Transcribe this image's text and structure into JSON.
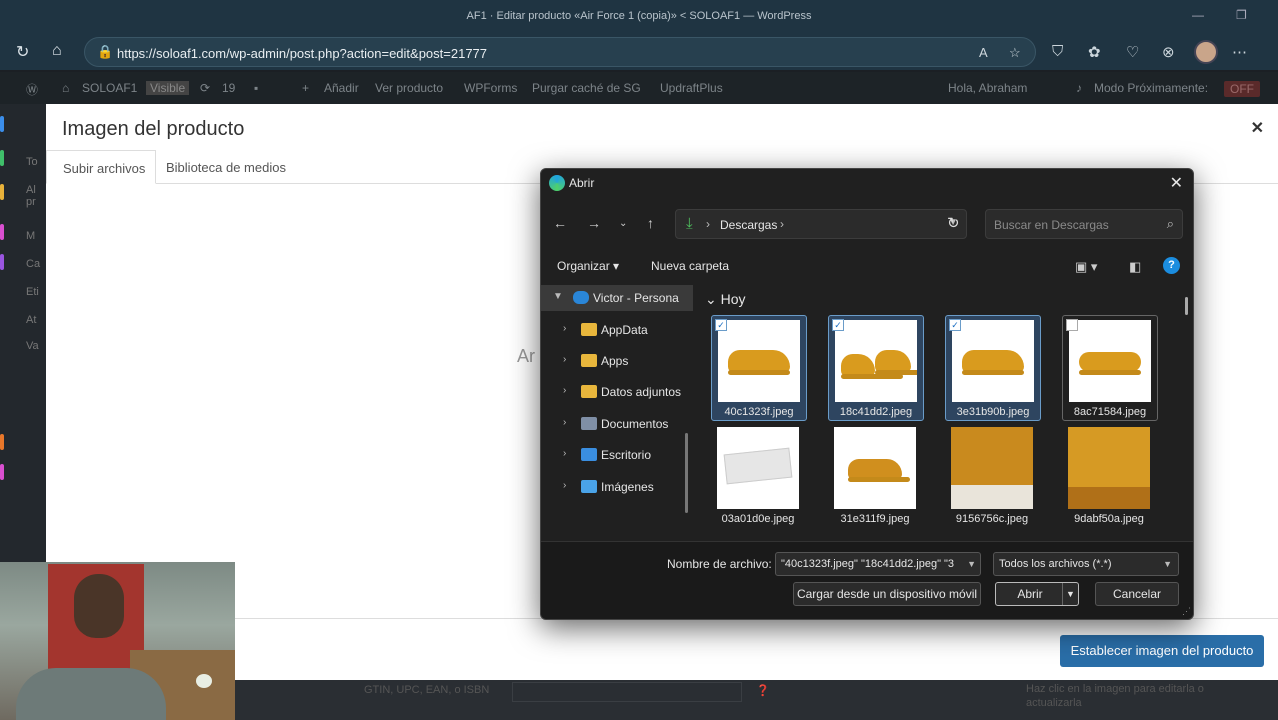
{
  "browser": {
    "window_title": "AF1 · Editar producto «Air Force 1 (copia)» < SOLOAF1 — WordPress",
    "url": "https://soloaf1.com/wp-admin/post.php?action=edit&post=21777"
  },
  "wp_admin_bar": {
    "site": "SOLOAF1",
    "visibility": "Visible",
    "updates": "19",
    "items": [
      "Añadir",
      "Ver producto",
      "WPForms",
      "Purgar caché de SG",
      "UpdraftPlus"
    ],
    "greeting": "Hola, Abraham",
    "mode_label": "Modo Próximamente:",
    "mode_value": "OFF"
  },
  "sidebar_fragments": [
    "To",
    "Al pr",
    "M",
    "Ca",
    "Eti",
    "At",
    "Va"
  ],
  "modal": {
    "title": "Imagen del producto",
    "tabs": [
      "Subir archivos",
      "Biblioteca de medios"
    ],
    "background_fragment": "Ar",
    "set_button": "Establecer imagen del producto"
  },
  "bottom_strip": {
    "left_text": "GTIN, UPC, EAN, o ISBN",
    "right_text": "Haz clic en la imagen para editarla o actualizarla"
  },
  "dialog": {
    "title": "Abrir",
    "breadcrumb": "Descargas",
    "search_placeholder": "Buscar en Descargas",
    "organize": "Organizar",
    "new_folder": "Nueva carpeta",
    "tree": [
      {
        "label": "Victor - Persona",
        "expanded": true,
        "icon": "onedrive-icon"
      },
      {
        "label": "AppData",
        "icon": "folder-icon"
      },
      {
        "label": "Apps",
        "icon": "folder-icon"
      },
      {
        "label": "Datos adjuntos",
        "icon": "folder-icon"
      },
      {
        "label": "Documentos",
        "icon": "documents-icon"
      },
      {
        "label": "Escritorio",
        "icon": "desktop-icon"
      },
      {
        "label": "Imágenes",
        "icon": "pictures-icon"
      }
    ],
    "group_header": "Hoy",
    "files": [
      {
        "name": "40c1323f.jpeg",
        "selected": true
      },
      {
        "name": "18c41dd2.jpeg",
        "selected": true
      },
      {
        "name": "3e31b90b.jpeg",
        "selected": true
      },
      {
        "name": "8ac71584.jpeg",
        "selected": false
      },
      {
        "name": "03a01d0e.jpeg",
        "selected": false
      },
      {
        "name": "31e311f9.jpeg",
        "selected": false
      },
      {
        "name": "9156756c.jpeg",
        "selected": false
      },
      {
        "name": "9dabf50a.jpeg",
        "selected": false
      }
    ],
    "filename_label": "Nombre de archivo:",
    "filename_value": "\"40c1323f.jpeg\" \"18c41dd2.jpeg\" \"3",
    "filetype_value": "Todos los archivos (*.*)",
    "upload_device": "Cargar desde un dispositivo móvil",
    "open_button": "Abrir",
    "cancel_button": "Cancelar"
  }
}
